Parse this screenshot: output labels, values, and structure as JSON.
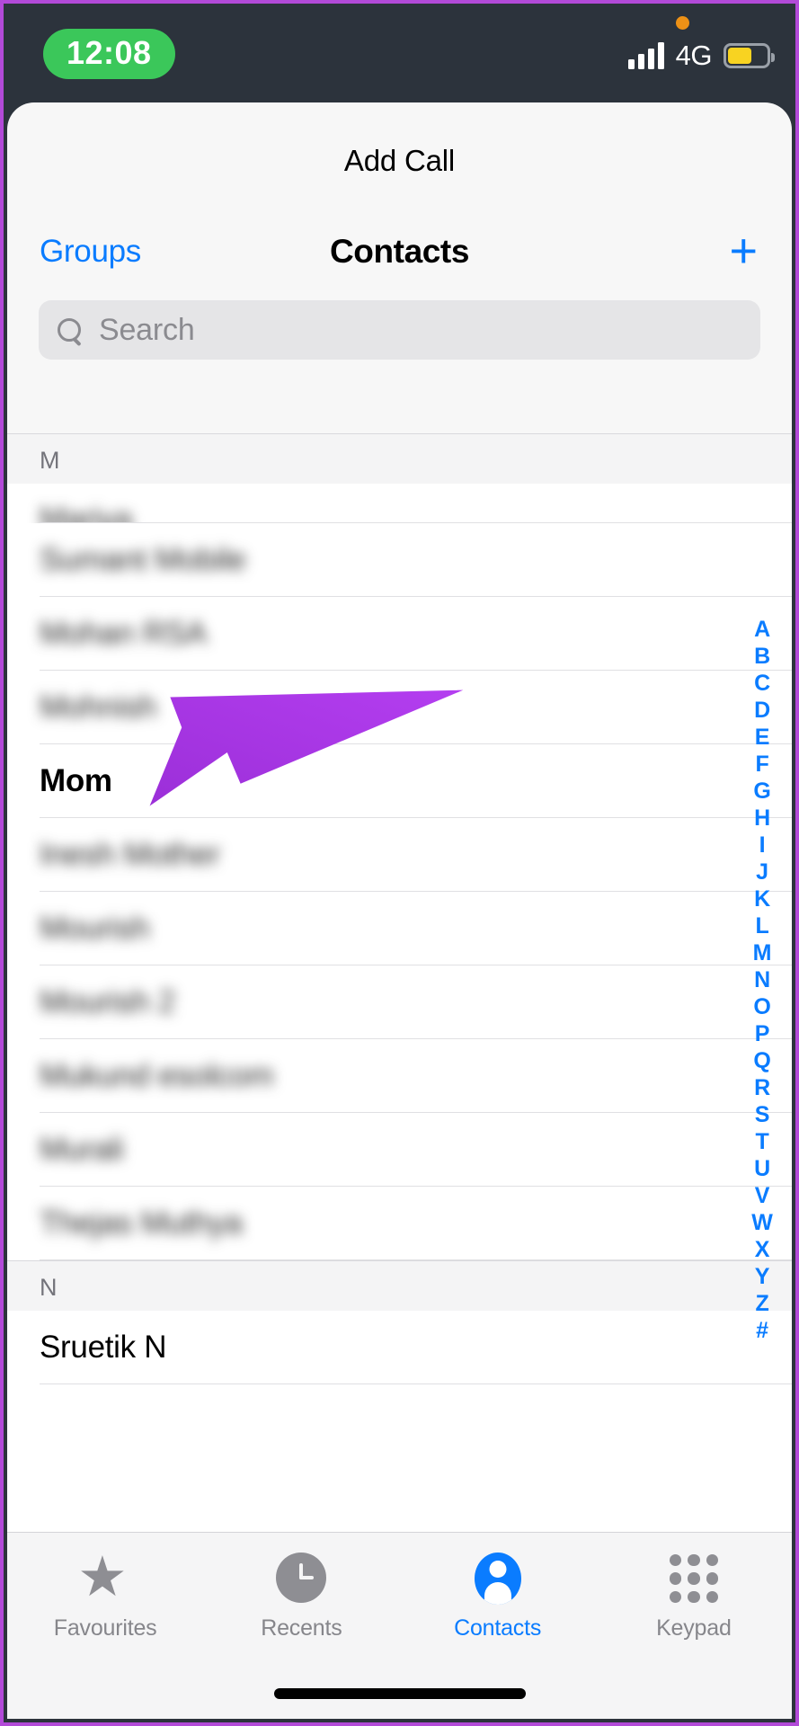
{
  "status_bar": {
    "time": "12:08",
    "network": "4G",
    "recording_indicator": "orange-dot",
    "signal_icon": "signal-bars-icon",
    "battery_icon": "battery-low-power-icon",
    "colors": {
      "background": "#2c333c",
      "time_pill": "#3bc75a",
      "battery_fill": "#f8d321",
      "dot": "#ed9116"
    }
  },
  "sheet": {
    "title": "Add Call"
  },
  "nav_bar": {
    "left_button": "Groups",
    "title": "Contacts",
    "right_button": "+",
    "accent_color": "#0a7cff"
  },
  "search": {
    "placeholder": "Search",
    "value": "",
    "icon": "search-icon"
  },
  "contacts": {
    "sections": [
      {
        "letter": "M",
        "rows": [
          {
            "name": "Mariya",
            "redacted": true,
            "clipped": true,
            "highlighted": false
          },
          {
            "name": "Sumant Mobile",
            "redacted": true,
            "clipped": false,
            "highlighted": false
          },
          {
            "name": "Mohan RSA",
            "redacted": true,
            "clipped": false,
            "highlighted": false
          },
          {
            "name": "Mohnish",
            "redacted": true,
            "clipped": false,
            "highlighted": false
          },
          {
            "name": "Mom",
            "redacted": false,
            "clipped": false,
            "highlighted": true
          },
          {
            "name": "Inesh Mother",
            "redacted": true,
            "clipped": false,
            "highlighted": false
          },
          {
            "name": "Mourish",
            "redacted": true,
            "clipped": false,
            "highlighted": false
          },
          {
            "name": "Mourish 2",
            "redacted": true,
            "clipped": false,
            "highlighted": false
          },
          {
            "name": "Mukund esolcom",
            "redacted": true,
            "clipped": false,
            "highlighted": false
          },
          {
            "name": "Murali",
            "redacted": true,
            "clipped": false,
            "highlighted": false
          },
          {
            "name": "Thejas Muthya",
            "redacted": true,
            "clipped": false,
            "highlighted": false
          }
        ]
      },
      {
        "letter": "N",
        "rows": [
          {
            "name": "Sruetik N",
            "redacted": false,
            "clipped": false,
            "highlighted": false
          }
        ]
      }
    ]
  },
  "alphabet_index": {
    "letters": [
      "A",
      "B",
      "C",
      "D",
      "E",
      "F",
      "G",
      "H",
      "I",
      "J",
      "K",
      "L",
      "M",
      "N",
      "O",
      "P",
      "Q",
      "R",
      "S",
      "T",
      "U",
      "V",
      "W",
      "X",
      "Y",
      "Z",
      "#"
    ],
    "color": "#0a7cff"
  },
  "annotation": {
    "type": "arrow",
    "points_to": "Mom",
    "color": "#a63de3",
    "color_light": "#c14ef2"
  },
  "tab_bar": {
    "tabs": [
      {
        "label": "Favourites",
        "icon": "star-icon",
        "active": false
      },
      {
        "label": "Recents",
        "icon": "clock-icon",
        "active": false
      },
      {
        "label": "Contacts",
        "icon": "person-icon",
        "active": true
      },
      {
        "label": "Keypad",
        "icon": "keypad-grid-icon",
        "active": false
      }
    ],
    "active_color": "#0a7cff",
    "inactive_color": "#86868b"
  },
  "home_indicator": "home-indicator-bar"
}
